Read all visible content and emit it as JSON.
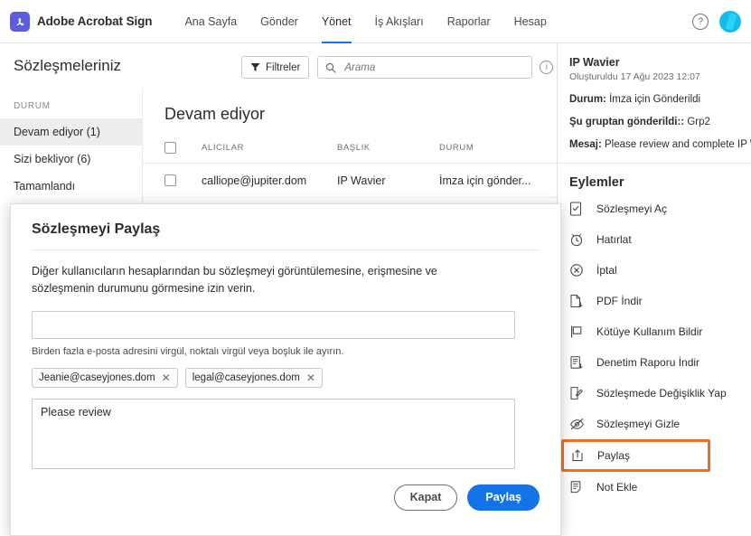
{
  "topnav": {
    "brand": "Adobe Acrobat Sign",
    "logo_icon": "adobe-acrobat-logo",
    "links": [
      {
        "label": "Ana Sayfa",
        "active": false
      },
      {
        "label": "Gönder",
        "active": false
      },
      {
        "label": "Yönet",
        "active": true
      },
      {
        "label": "İş Akışları",
        "active": false
      },
      {
        "label": "Raporlar",
        "active": false
      },
      {
        "label": "Hesap",
        "active": false
      }
    ],
    "help_icon": "question-mark-icon",
    "avatar_icon": "user-avatar",
    "avatar_color": "#13bdea"
  },
  "page": {
    "title": "Sözleşmeleriniz",
    "filter_button": "Filtreler",
    "filter_icon": "funnel-icon",
    "search_icon": "search-icon",
    "search_placeholder": "Arama",
    "search_value": "",
    "info_icon": "info-icon"
  },
  "sidebar": {
    "heading": "DURUM",
    "items": [
      {
        "label": "Devam ediyor (1)",
        "selected": true
      },
      {
        "label": "Sizi bekliyor (6)",
        "selected": false
      },
      {
        "label": "Tamamlandı",
        "selected": false
      }
    ]
  },
  "list": {
    "title": "Devam ediyor",
    "columns": [
      "ALICILAR",
      "BAŞLIK",
      "DURUM"
    ],
    "rows": [
      {
        "recipient": "calliope@jupiter.dom",
        "title": "IP Wavier",
        "status": "İmza için gönder..."
      }
    ]
  },
  "detail": {
    "title": "IP Wavier",
    "created": "Oluşturuldu 17 Ağu 2023 12:07",
    "status_label": "Durum:",
    "status_value": "İmza için Gönderildi",
    "group_label": "Şu gruptan gönderildi::",
    "group_value": "Grp2",
    "message_label": "Mesaj:",
    "message_value": "Please review and complete IP Wav",
    "actions_title": "Eylemler",
    "highlight_color": "#ea7023",
    "actions": [
      {
        "label": "Sözleşmeyi Aç",
        "icon": "document-open-icon",
        "highlighted": false
      },
      {
        "label": "Hatırlat",
        "icon": "alarm-clock-icon",
        "highlighted": false
      },
      {
        "label": "İptal",
        "icon": "cancel-circle-icon",
        "highlighted": false
      },
      {
        "label": "PDF İndir",
        "icon": "pdf-download-icon",
        "highlighted": false
      },
      {
        "label": "Kötüye Kullanım Bildir",
        "icon": "flag-icon",
        "highlighted": false
      },
      {
        "label": "Denetim Raporu İndir",
        "icon": "report-download-icon",
        "highlighted": false
      },
      {
        "label": "Sözleşmede Değişiklik Yap",
        "icon": "document-edit-icon",
        "highlighted": false
      },
      {
        "label": "Sözleşmeyi Gizle",
        "icon": "eye-hidden-icon",
        "highlighted": false
      },
      {
        "label": "Paylaş",
        "icon": "share-upload-icon",
        "highlighted": true
      },
      {
        "label": "Not Ekle",
        "icon": "note-add-icon",
        "highlighted": false
      }
    ]
  },
  "modal": {
    "title": "Sözleşmeyi Paylaş",
    "description": "Diğer kullanıcıların hesaplarından bu sözleşmeyi görüntülemesine, erişmesine ve sözleşmenin durumunu görmesine izin verin.",
    "email_input_value": "",
    "email_input_placeholder": "",
    "hint": "Birden fazla e-posta adresini virgül, noktalı virgül veya boşluk ile ayırın.",
    "chips": [
      {
        "email": "Jeanie@caseyjones.dom",
        "remove_icon": "close-icon"
      },
      {
        "email": "legal@caseyjones.dom",
        "remove_icon": "close-icon"
      }
    ],
    "message_value": "Please review",
    "cancel_label": "Kapat",
    "share_label": "Paylaş",
    "share_color": "#1473e6"
  }
}
